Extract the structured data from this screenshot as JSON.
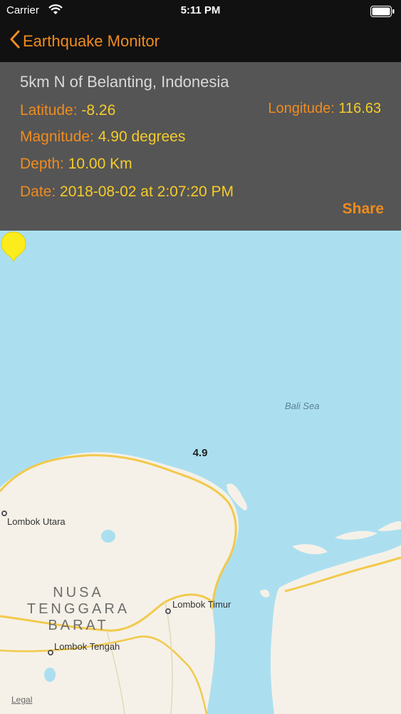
{
  "status_bar": {
    "carrier": "Carrier",
    "time": "5:11 PM"
  },
  "nav": {
    "back_title": "Earthquake Monitor",
    "accent_color": "#f08c1e"
  },
  "quake": {
    "place": "5km N of Belanting, Indonesia",
    "latitude_label": "Latitude:",
    "latitude": "-8.26",
    "longitude_label": "Longitude:",
    "longitude": "116.63",
    "magnitude_label": "Magnitude:",
    "magnitude": "4.90 degrees",
    "depth_label": "Depth:",
    "depth": "10.00 Km",
    "date_label": "Date:",
    "date": "2018-08-02 at 2:07:20 PM",
    "share_label": "Share"
  },
  "map": {
    "pin_value": "4.9",
    "sea_label": "Bali Sea",
    "places": [
      "Lombok Utara",
      "Lombok Timur",
      "Lombok Tengah"
    ],
    "region_lines": [
      "NUSA",
      "TENGGARA",
      "BARAT"
    ],
    "legal": "Legal",
    "water_color": "#abdff0",
    "land_color": "#f5f1e8",
    "road_color": "#f2c94c",
    "pin_color": "#fcec1c"
  }
}
